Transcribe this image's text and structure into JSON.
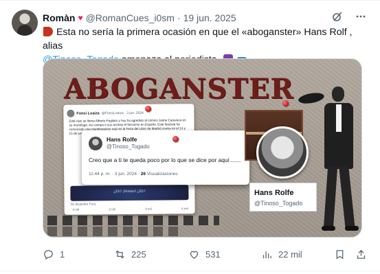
{
  "tweet": {
    "author_name": "Romàn",
    "author_handle": "@RomanCues_i0sm",
    "separator": "·",
    "date": "19 jun. 2025",
    "text_part1": "Esta no sería la primera ocasión en que el «aboganster» Hans Rolf , alias",
    "mention": "@Tinoso_Togado",
    "text_part2": "amenaza al periodista.",
    "emojis": [
      "megaphone-icon",
      "books-icon",
      "down-arrow-icon"
    ]
  },
  "media": {
    "headline": "ABOGANSTER",
    "embedded_tweet_1": {
      "name": "Fonsi Loaiza",
      "handle": "@FonsiLoaiza · 3 jun. 2024",
      "body": "Este nazi se llama Alberto Pugilato y hoy ha agredido al cómico Jaime Caravaca en su monólogo. Así campa a sus anchas el fascismo en España. Este fascista ha convocado una manifestación nazi en la Feria del Libro de Madrid contra mí el 14 y 15 de junio.",
      "image_caption": "¿Eh? ¡Rontarí! ¿Eh?",
      "footer": "De Alejandra Ponz",
      "actions": [
        "9 mil",
        "2 mil",
        "9 mil",
        "8 mil"
      ]
    },
    "embedded_tweet_2": {
      "name": "Hans Rolfe",
      "handle": "@Tinoso_Togado",
      "body": "Creo que a ti te queda poco por lo que se dice por aquí.......",
      "time": "11:44 p. m. · 3 jun. 2024 ·",
      "views_count": "26",
      "views_label": "Visualizaciones"
    },
    "profile": {
      "name": "Hans Rolfe",
      "handle": "@Tinoso_Togado"
    }
  },
  "actions": {
    "replies": "1",
    "reposts": "225",
    "likes": "531",
    "views": "22 mil"
  }
}
